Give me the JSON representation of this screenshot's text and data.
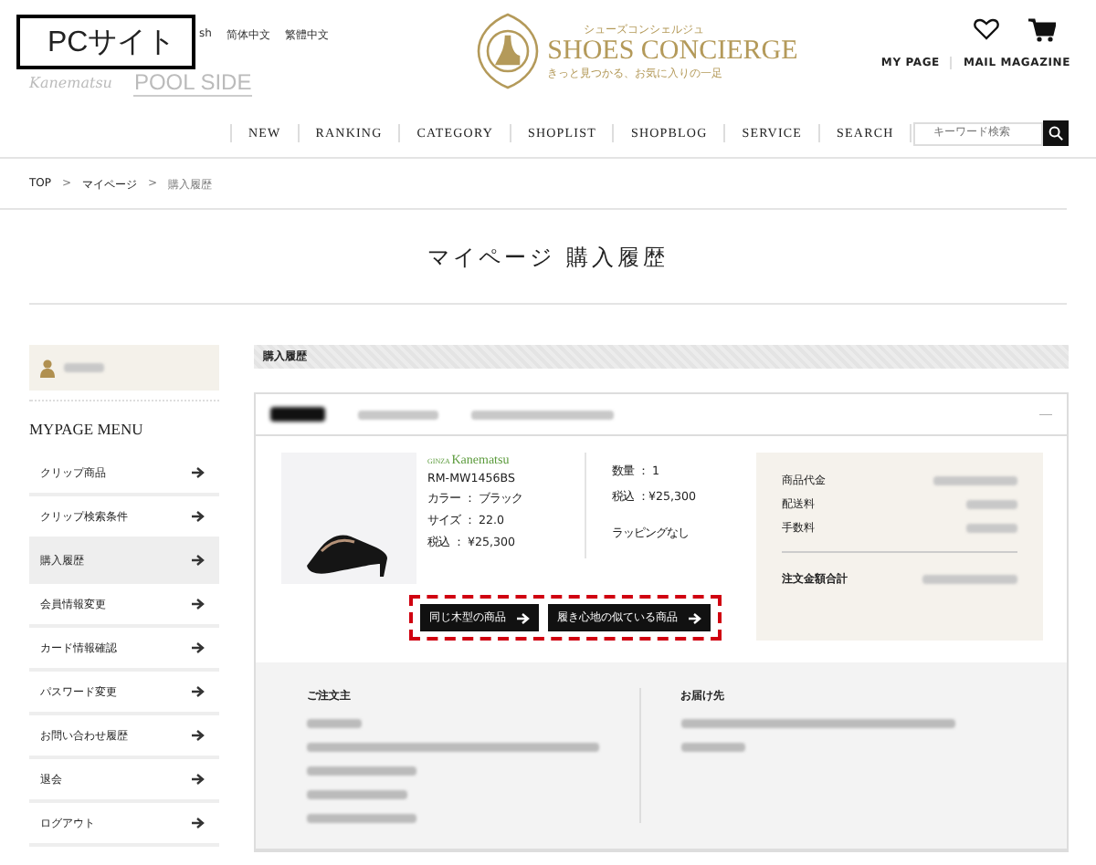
{
  "annotation": {
    "label": "PCサイト"
  },
  "languages": [
    "sh",
    "简体中文",
    "繁體中文"
  ],
  "brand_logos": [
    "Kanematsu",
    "POOL SIDE"
  ],
  "logo": {
    "kana": "シューズコンシェルジュ",
    "name": "SHOES CONCIERGE",
    "tagline": "きっと見つかる、お気に入りの一足"
  },
  "header_links": [
    "MY PAGE",
    "MAIL MAGAZINE"
  ],
  "nav": [
    "NEW",
    "RANKING",
    "CATEGORY",
    "SHOPLIST",
    "SHOPBLOG",
    "SERVICE",
    "SEARCH"
  ],
  "search": {
    "placeholder": "キーワード検索"
  },
  "breadcrumb": {
    "separator": ">",
    "items": [
      "TOP",
      "マイページ",
      "購入履歴"
    ]
  },
  "page_title": "マイページ 購入履歴",
  "sidebar": {
    "heading": "MYPAGE MENU",
    "items": [
      {
        "label": "クリップ商品",
        "selected": false
      },
      {
        "label": "クリップ検索条件",
        "selected": false
      },
      {
        "label": "購入履歴",
        "selected": true
      },
      {
        "label": "会員情報変更",
        "selected": false
      },
      {
        "label": "カード情報確認",
        "selected": false
      },
      {
        "label": "パスワード変更",
        "selected": false
      },
      {
        "label": "お問い合わせ履歴",
        "selected": false
      },
      {
        "label": "退会",
        "selected": false
      },
      {
        "label": "ログアウト",
        "selected": false
      }
    ]
  },
  "section_title": "購入履歴",
  "order": {
    "collapse": "—",
    "item": {
      "brand_prefix": "GINZA",
      "brand": "Kanematsu",
      "code": "RM-MW1456BS",
      "colour_text": "カラー ： ブラック",
      "size": "サイズ ： 22.0",
      "price": "税込 ： ¥25,300",
      "quantity": "数量 ： 1",
      "price_2": "税込 ：¥25,300",
      "wrapping": "ラッピングなし"
    },
    "summary": {
      "rows": [
        "商品代金",
        "配送料",
        "手数料"
      ],
      "total": "注文金額合計"
    },
    "buttons": [
      "同じ木型の商品",
      "履き心地の似ている商品"
    ],
    "orderer": {
      "heading": "ご注文主"
    },
    "delivery": {
      "heading": "お届け先"
    }
  }
}
